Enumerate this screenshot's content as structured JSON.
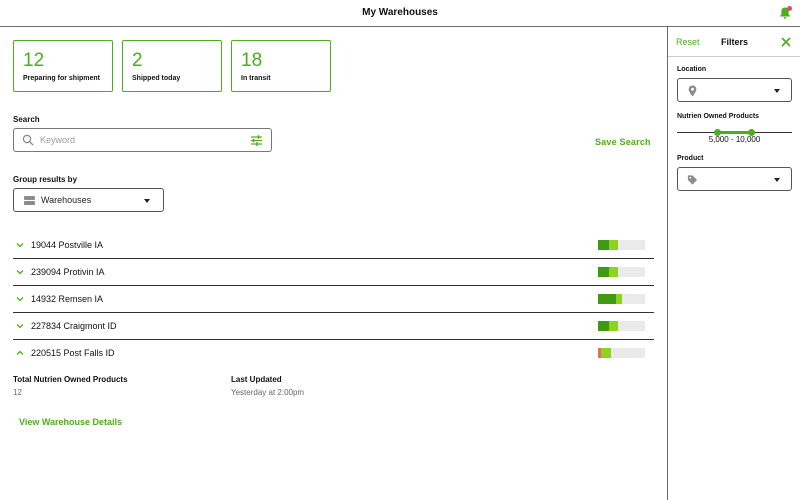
{
  "header": {
    "title": "My Warehouses"
  },
  "stats": [
    {
      "value": "12",
      "label": "Preparing for shipment"
    },
    {
      "value": "2",
      "label": "Shipped today"
    },
    {
      "value": "18",
      "label": "In transit"
    }
  ],
  "search": {
    "label": "Search",
    "placeholder": "Keyword",
    "save_label": "Save Search"
  },
  "group": {
    "label": "Group results by",
    "value": "Warehouses"
  },
  "warehouses": [
    {
      "name": "19044 Postville IA",
      "expanded": false,
      "bar": [
        {
          "fraction": 0.23,
          "color": "#3f9a12"
        },
        {
          "fraction": 0.19,
          "color": "#8ed323"
        }
      ]
    },
    {
      "name": "239094 Protivin IA",
      "expanded": false,
      "bar": [
        {
          "fraction": 0.23,
          "color": "#3f9a12"
        },
        {
          "fraction": 0.19,
          "color": "#8ed323"
        }
      ]
    },
    {
      "name": "14932 Remsen IA",
      "expanded": false,
      "bar": [
        {
          "fraction": 0.38,
          "color": "#3f9a12"
        },
        {
          "fraction": 0.13,
          "color": "#8ed323"
        }
      ]
    },
    {
      "name": "227834 Craigmont ID",
      "expanded": false,
      "bar": [
        {
          "fraction": 0.23,
          "color": "#3f9a12"
        },
        {
          "fraction": 0.19,
          "color": "#8ed323"
        }
      ]
    },
    {
      "name": "220515 Post Falls ID",
      "expanded": true,
      "bar": [
        {
          "fraction": 0.06,
          "color": "#e86a5a"
        },
        {
          "fraction": 0.21,
          "color": "#8ed323"
        }
      ]
    }
  ],
  "detail": {
    "total_label": "Total Nutrien Owned Products",
    "total_value": "12",
    "updated_label": "Last Updated",
    "updated_value": "Yesterday at 2:00pm",
    "view_link": "View Warehouse Details"
  },
  "filters": {
    "reset": "Reset",
    "title": "Filters",
    "location_label": "Location",
    "owned_label": "Nutrien Owned Products",
    "owned_range": "5,000 - 10,000",
    "owned_slider": {
      "low_fraction": 0.35,
      "high_fraction": 0.65
    },
    "product_label": "Product"
  },
  "colors": {
    "accent": "#4cae1c",
    "notification": "#e04b6c"
  }
}
